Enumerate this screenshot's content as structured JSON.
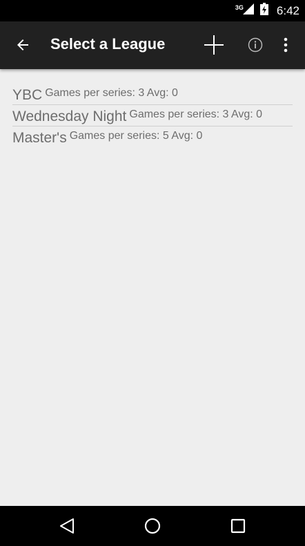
{
  "status_bar": {
    "network_type": "3G",
    "time": "6:42",
    "icons": [
      "signal-icon",
      "battery-icon"
    ]
  },
  "app_bar": {
    "title": "Select a League",
    "back_icon": "arrow-back-icon",
    "actions": [
      "add-icon",
      "info-icon",
      "more-vert-icon"
    ]
  },
  "leagues": [
    {
      "name": "YBC",
      "details": "Games per series: 3 Avg: 0"
    },
    {
      "name": "Wednesday Night",
      "details": "Games per series: 3 Avg: 0"
    },
    {
      "name": "Master's",
      "details": "Games per series: 5 Avg: 0"
    }
  ],
  "nav_bar": {
    "buttons": [
      "nav-back-icon",
      "nav-home-icon",
      "nav-recents-icon"
    ]
  },
  "colors": {
    "app_bar": "#212121",
    "background": "#eeeeee",
    "text_secondary": "#6d6d6d",
    "divider": "#cfcfcf"
  }
}
